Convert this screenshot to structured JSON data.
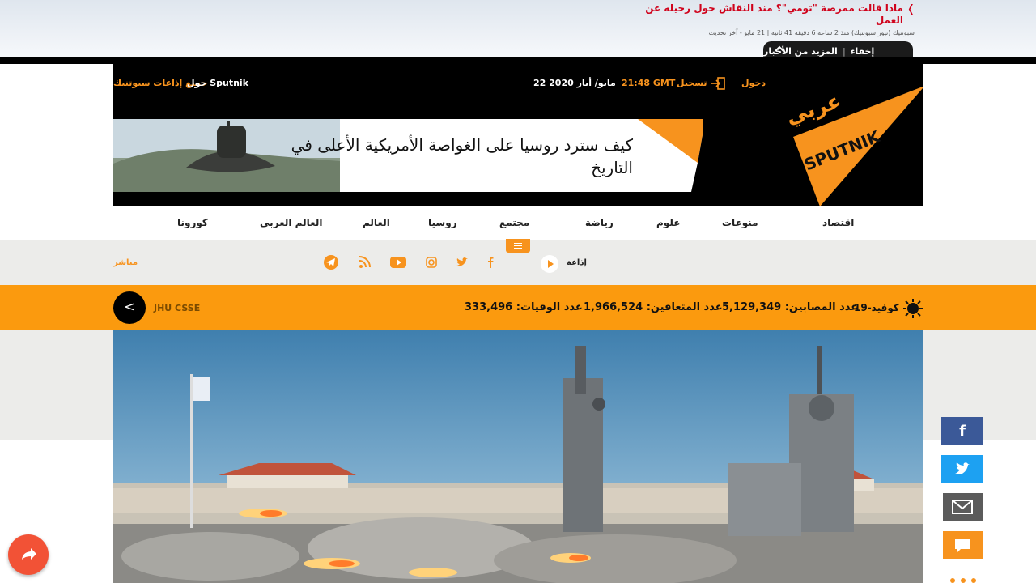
{
  "ticker": {
    "headline": "ماذا قالت ممرضة \"تومي\"؟ منذ النقاش حول رحيله عن العمل",
    "meta": "سبوتنيك (نيوز سبوتنيك) منذ 2 ساعة 6 دقيقة 41 ثانية | 21 مايو - آخر تحديث",
    "more_news": "المزيد من الأخبار",
    "hide": "إخفاء"
  },
  "header": {
    "all_radio": "جميع إذاعات سبوتنيك",
    "about": "حول Sputnik",
    "datetime": "21:48 GMT 22 مايو/ أيار 2020",
    "time": "21:48 GMT",
    "date": "22 مايو/ أيار 2020",
    "login_label": "دخول",
    "register_label": "تسجيل",
    "logo_arabic": "عربي",
    "logo_text": "SPUTNIK"
  },
  "banner": {
    "text": "كيف سترد روسيا على الغواصة الأمريكية الأعلى في التاريخ"
  },
  "nav": {
    "items": [
      "كورونا",
      "العالم العربي",
      "العالم",
      "روسيا",
      "مجتمع",
      "رياضة",
      "علوم",
      "منوعات",
      "اقتصاد"
    ]
  },
  "subbar": {
    "live_label": "مباشر",
    "radio_label": "إذاعة",
    "icons": [
      "telegram-icon",
      "rss-icon",
      "youtube-icon",
      "instagram-icon",
      "twitter-icon",
      "facebook-icon"
    ]
  },
  "covid": {
    "source": "JHU CSSE",
    "title": "كوفيد-19",
    "confirmed_label": "عدد المصابين:",
    "confirmed": "5,129,349",
    "recovered_label": "عدد المتعافين:",
    "recovered": "1,966,524",
    "deaths_label": "عدد الوفيات:",
    "deaths": "333,496"
  },
  "colors": {
    "brand_orange": "#f7931e",
    "covid_bar": "#fb9a0e",
    "ticker_red": "#d0021b",
    "facebook": "#3b5998",
    "twitter": "#1da1f2"
  }
}
